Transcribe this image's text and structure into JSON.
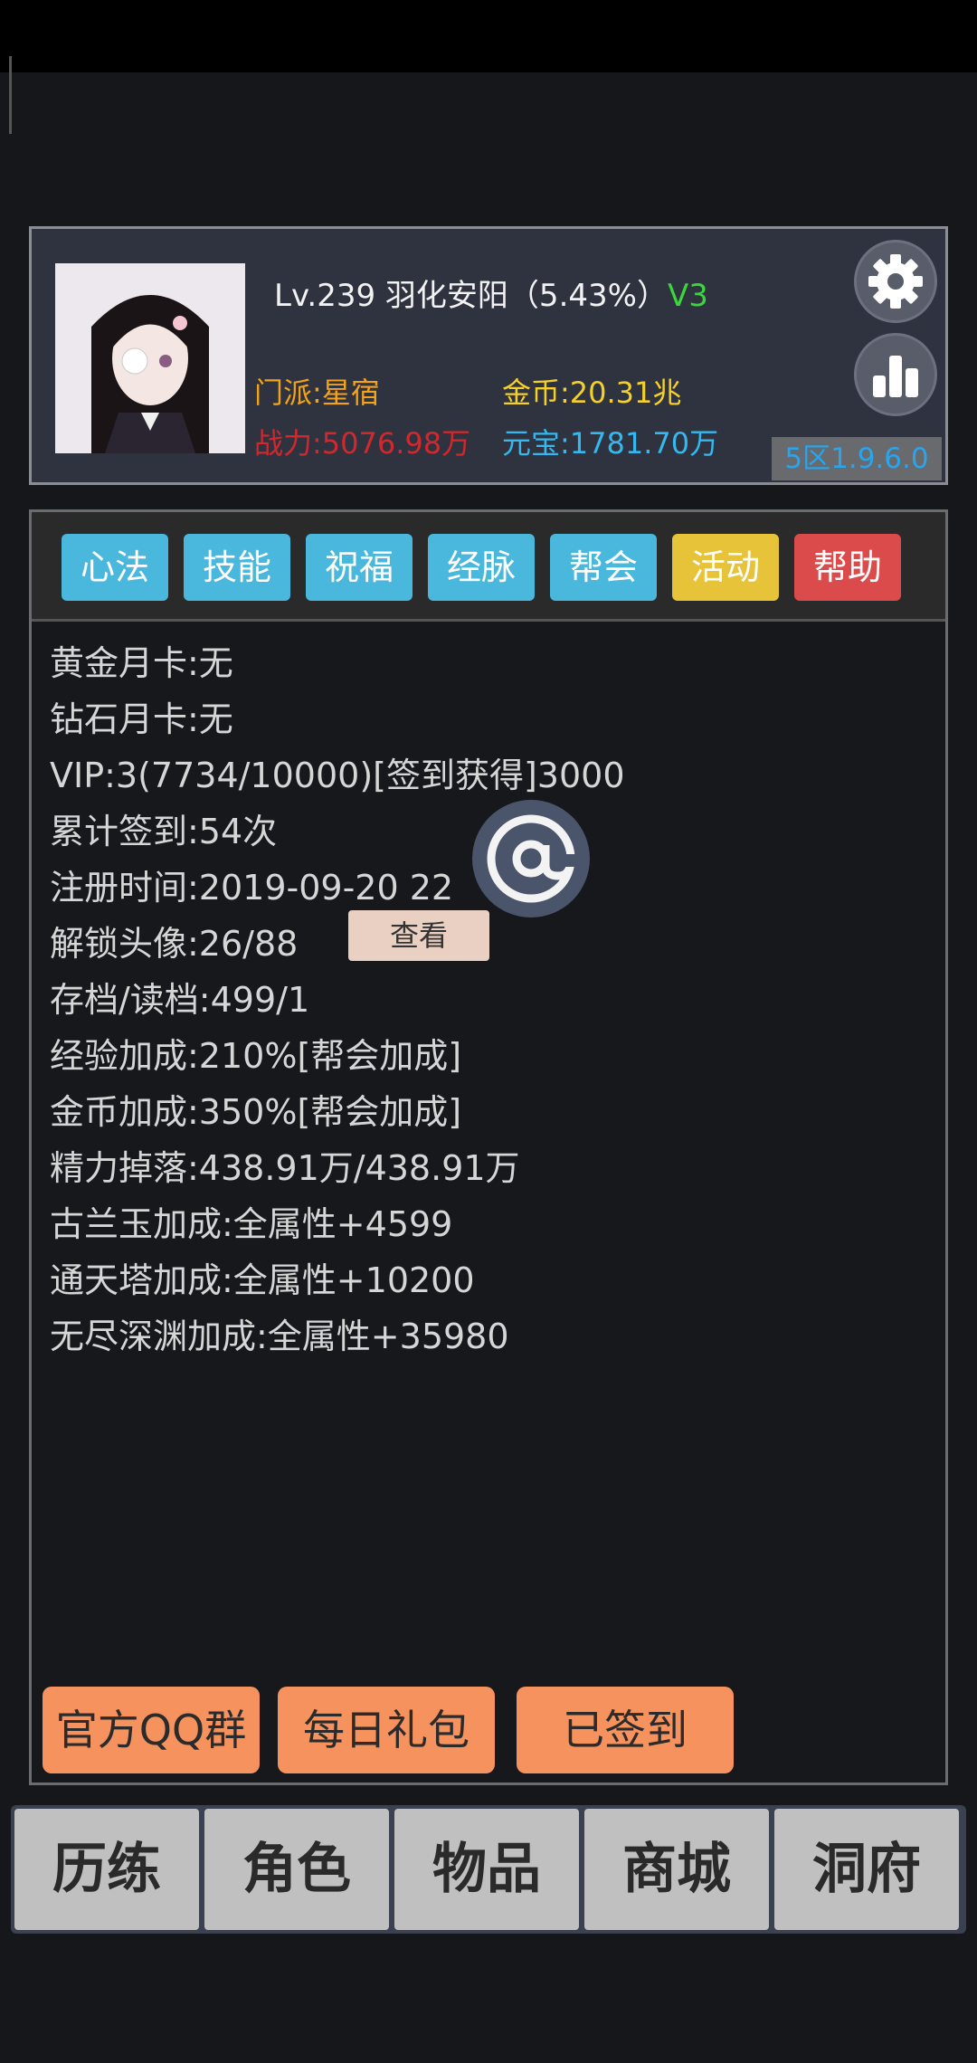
{
  "profile": {
    "level_name": "Lv.239 羽化安阳（5.43%）",
    "vip_badge": "V3",
    "sect": "门派:星宿",
    "power": "战力:5076.98万",
    "gold": "金币:20.31兆",
    "ingot": "元宝:1781.70万",
    "version": "5区1.9.6.0",
    "icons": [
      "gear-icon",
      "bar-chart-icon"
    ]
  },
  "tabs": [
    {
      "label": "心法",
      "color": "#4ab7dd"
    },
    {
      "label": "技能",
      "color": "#4ab7dd"
    },
    {
      "label": "祝福",
      "color": "#4ab7dd"
    },
    {
      "label": "经脉",
      "color": "#4ab7dd"
    },
    {
      "label": "帮会",
      "color": "#4ab7dd"
    },
    {
      "label": "活动",
      "color": "#e7c33a"
    },
    {
      "label": "帮助",
      "color": "#dc4b4b"
    }
  ],
  "info": [
    "黄金月卡:无",
    "钻石月卡:无",
    "VIP:3(7734/10000)[签到获得]3000",
    "累计签到:54次",
    "注册时间:2019-09-20 22",
    "解锁头像:26/88",
    "存档/读档:499/1",
    "经验加成:210%[帮会加成]",
    "金币加成:350%[帮会加成]",
    "精力掉落:438.91万/438.91万",
    "古兰玉加成:全属性+4599",
    "通天塔加成:全属性+10200",
    "无尽深渊加成:全属性+35980"
  ],
  "view_button": "查看",
  "actions": [
    "官方QQ群",
    "每日礼包",
    "已签到"
  ],
  "floating_icon": "at-icon",
  "nav": [
    "历练",
    "角色",
    "物品",
    "商城",
    "洞府"
  ]
}
